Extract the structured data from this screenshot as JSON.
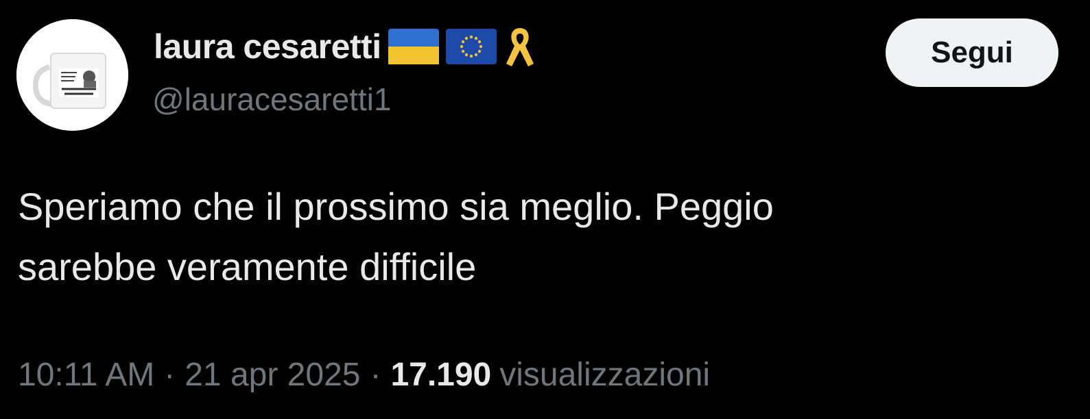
{
  "author": {
    "display_name": "laura cesaretti",
    "handle": "@lauracesaretti1",
    "badges": [
      "ukraine-flag-icon",
      "eu-flag-icon",
      "yellow-ribbon-icon"
    ]
  },
  "follow_button": {
    "label": "Segui"
  },
  "tweet": {
    "text_lines": [
      "Speriamo che il prossimo sia meglio. Peggio",
      "sarebbe veramente difficile"
    ]
  },
  "meta": {
    "time": "10:11 AM",
    "separator": "·",
    "date": "21 apr 2025",
    "views_count": "17.190",
    "views_label": "visualizzazioni"
  },
  "colors": {
    "background": "#000000",
    "primary_text": "#e7e9ea",
    "secondary_text": "#71767b",
    "button_bg": "#eff3f4",
    "button_text": "#0f1419",
    "ukraine_blue": "#2f6fcf",
    "ukraine_yellow": "#f2c230",
    "eu_blue": "#1d4aa8",
    "ribbon_yellow": "#f5c242"
  }
}
